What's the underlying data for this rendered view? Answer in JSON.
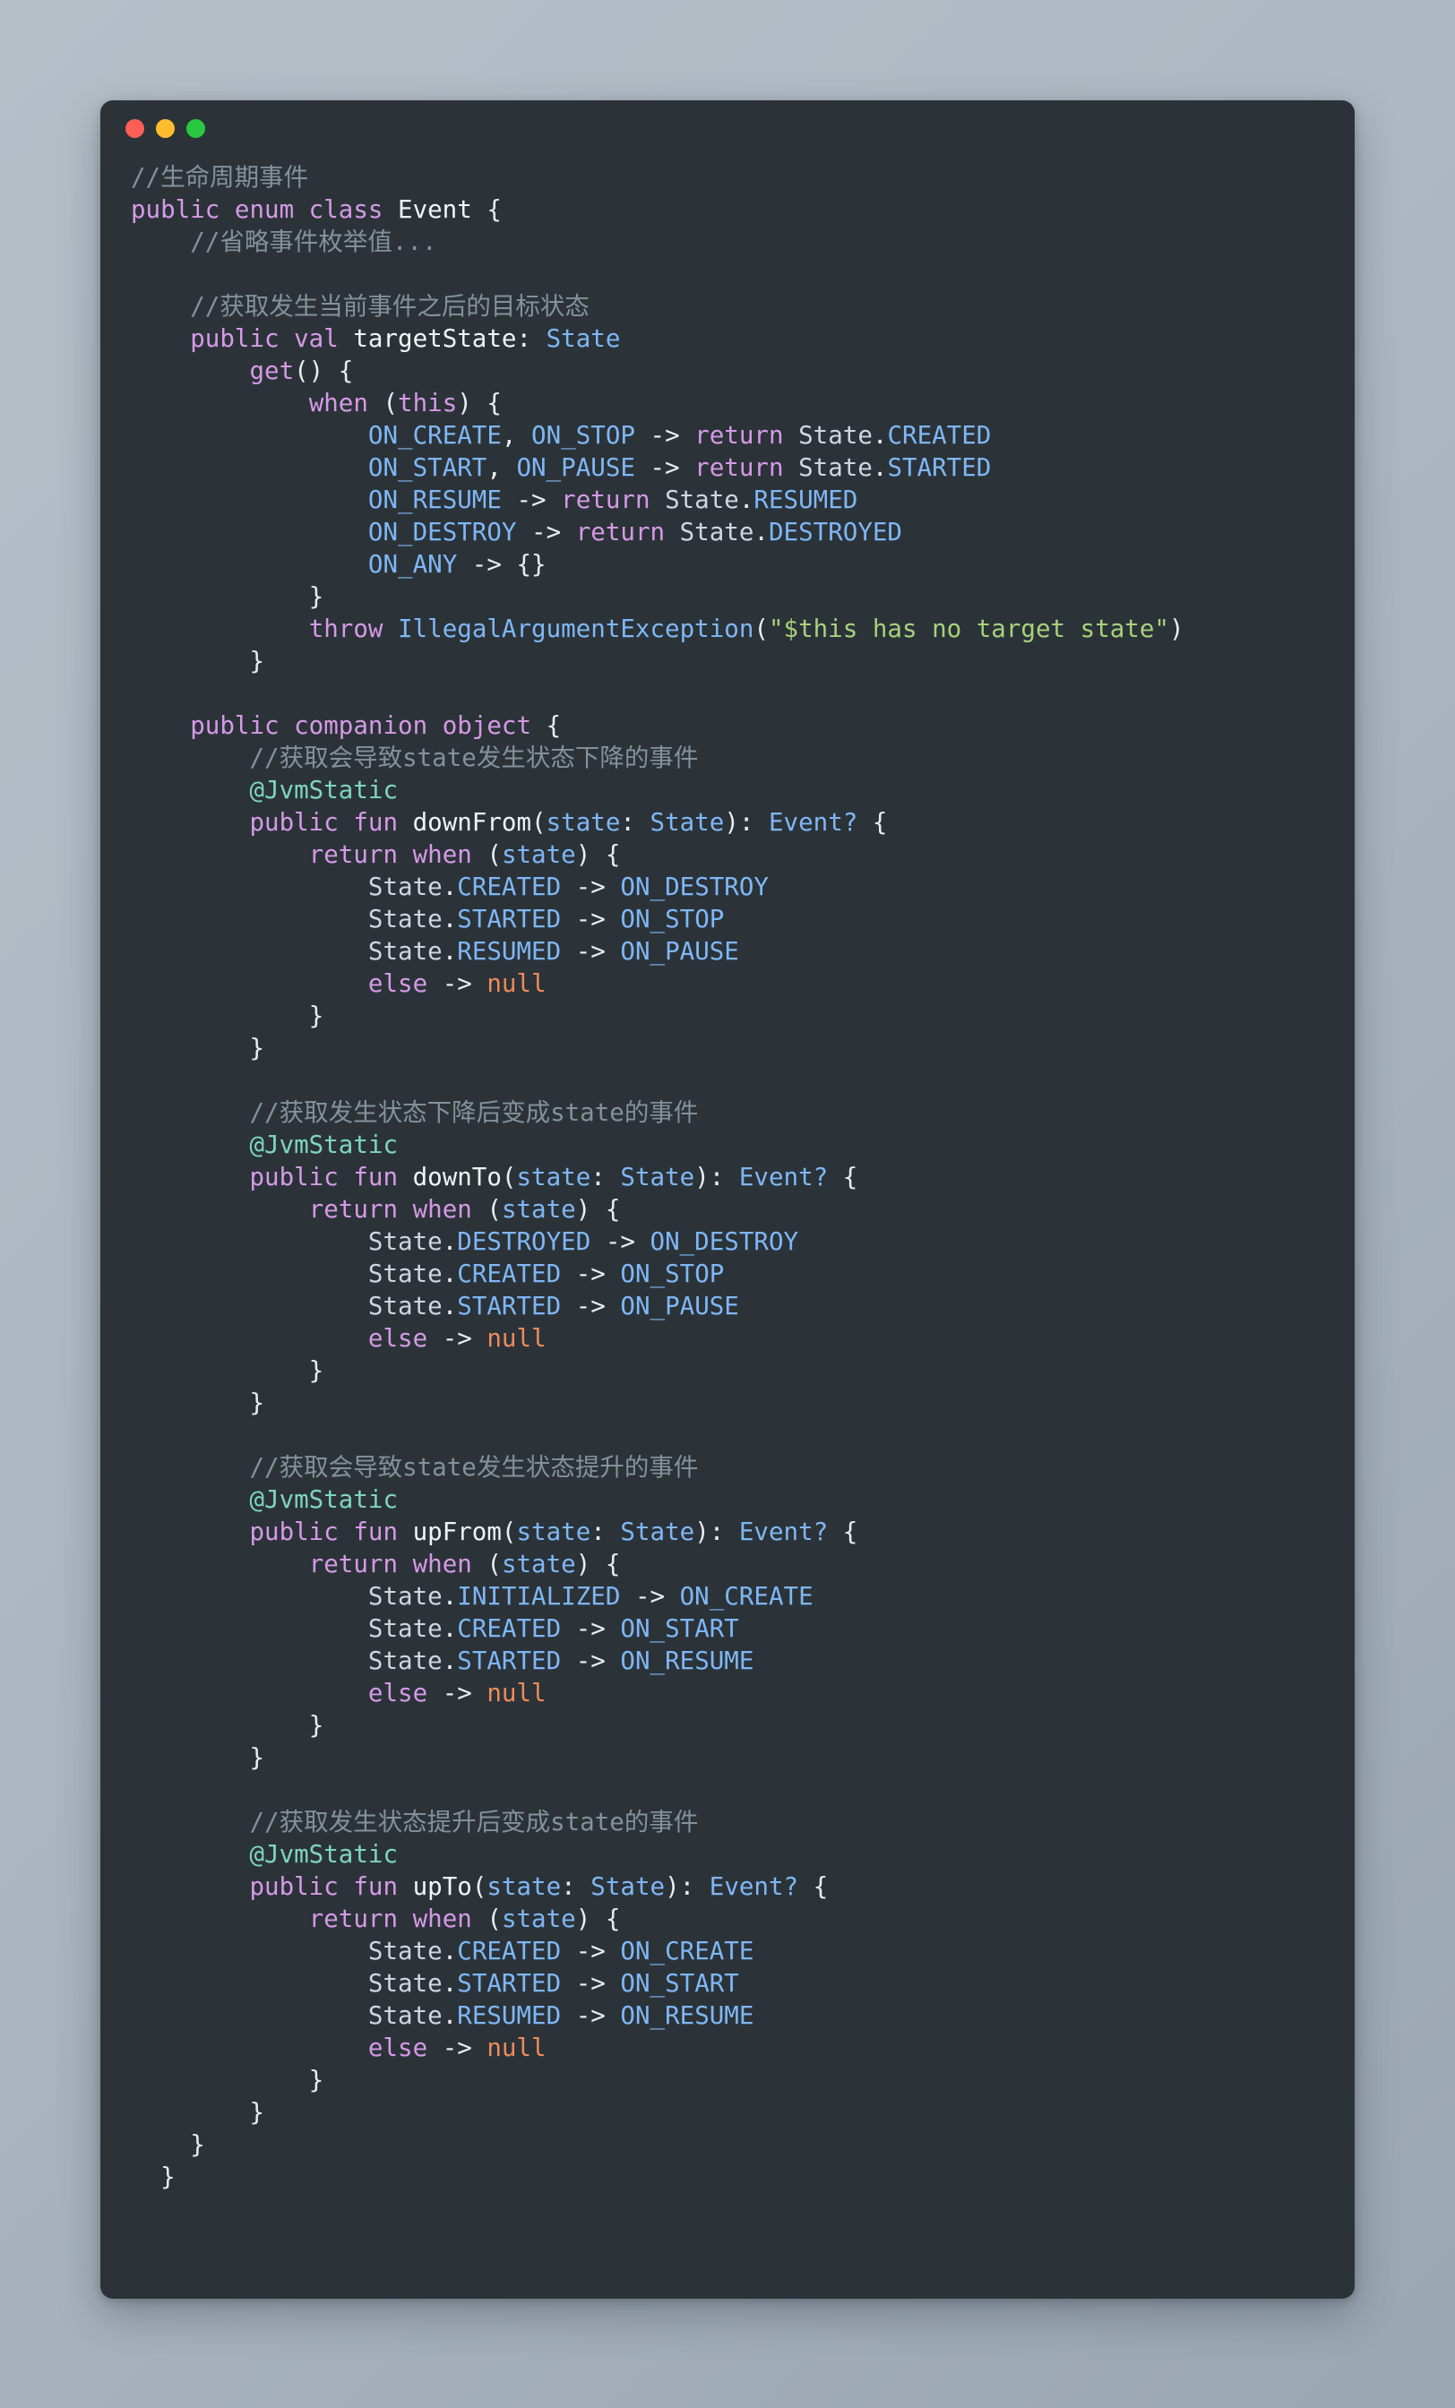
{
  "window": {
    "traffic_lights": [
      {
        "name": "close",
        "color": "#ff5f57"
      },
      {
        "name": "minimize",
        "color": "#ffbd2e"
      },
      {
        "name": "maximize",
        "color": "#28c840"
      }
    ],
    "background_color": "#2b3339",
    "page_background": "#aeb8c2"
  },
  "theme": {
    "comment": "#859199",
    "keyword": "#d699e6",
    "type": "#7fb7f5",
    "function": "#f2f5f7",
    "punctuation": "#e8edf1",
    "string": "#a7d17a",
    "annotation": "#7fd6bb",
    "null": "#ef8a5a",
    "foreground": "#d3dae3"
  },
  "code": {
    "language": "Kotlin",
    "lines": [
      {
        "indent": 0,
        "tokens": [
          {
            "t": "//生命周期事件",
            "c": "cmt"
          }
        ]
      },
      {
        "indent": 0,
        "tokens": [
          {
            "t": "public enum class ",
            "c": "kw"
          },
          {
            "t": "Event",
            "c": "fn"
          },
          {
            "t": " {",
            "c": "pun"
          }
        ]
      },
      {
        "indent": 4,
        "tokens": [
          {
            "t": "//省略事件枚举值...",
            "c": "cmt"
          }
        ]
      },
      {
        "indent": 0,
        "tokens": []
      },
      {
        "indent": 4,
        "tokens": [
          {
            "t": "//获取发生当前事件之后的目标状态",
            "c": "cmt"
          }
        ]
      },
      {
        "indent": 4,
        "tokens": [
          {
            "t": "public val ",
            "c": "kw"
          },
          {
            "t": "targetState",
            "c": "fn"
          },
          {
            "t": ": ",
            "c": "pun"
          },
          {
            "t": "State",
            "c": "typ"
          }
        ]
      },
      {
        "indent": 8,
        "tokens": [
          {
            "t": "get",
            "c": "kw"
          },
          {
            "t": "() {",
            "c": "pun"
          }
        ]
      },
      {
        "indent": 12,
        "tokens": [
          {
            "t": "when ",
            "c": "kw"
          },
          {
            "t": "(",
            "c": "pun"
          },
          {
            "t": "this",
            "c": "kw"
          },
          {
            "t": ") {",
            "c": "pun"
          }
        ]
      },
      {
        "indent": 16,
        "tokens": [
          {
            "t": "ON_CREATE",
            "c": "typ"
          },
          {
            "t": ", ",
            "c": "pun"
          },
          {
            "t": "ON_STOP",
            "c": "typ"
          },
          {
            "t": " -> ",
            "c": "pun"
          },
          {
            "t": "return ",
            "c": "kw"
          },
          {
            "t": "State",
            "c": "ident"
          },
          {
            "t": ".",
            "c": "pun"
          },
          {
            "t": "CREATED",
            "c": "typ"
          }
        ]
      },
      {
        "indent": 16,
        "tokens": [
          {
            "t": "ON_START",
            "c": "typ"
          },
          {
            "t": ", ",
            "c": "pun"
          },
          {
            "t": "ON_PAUSE",
            "c": "typ"
          },
          {
            "t": " -> ",
            "c": "pun"
          },
          {
            "t": "return ",
            "c": "kw"
          },
          {
            "t": "State",
            "c": "ident"
          },
          {
            "t": ".",
            "c": "pun"
          },
          {
            "t": "STARTED",
            "c": "typ"
          }
        ]
      },
      {
        "indent": 16,
        "tokens": [
          {
            "t": "ON_RESUME",
            "c": "typ"
          },
          {
            "t": " -> ",
            "c": "pun"
          },
          {
            "t": "return ",
            "c": "kw"
          },
          {
            "t": "State",
            "c": "ident"
          },
          {
            "t": ".",
            "c": "pun"
          },
          {
            "t": "RESUMED",
            "c": "typ"
          }
        ]
      },
      {
        "indent": 16,
        "tokens": [
          {
            "t": "ON_DESTROY",
            "c": "typ"
          },
          {
            "t": " -> ",
            "c": "pun"
          },
          {
            "t": "return ",
            "c": "kw"
          },
          {
            "t": "State",
            "c": "ident"
          },
          {
            "t": ".",
            "c": "pun"
          },
          {
            "t": "DESTROYED",
            "c": "typ"
          }
        ]
      },
      {
        "indent": 16,
        "tokens": [
          {
            "t": "ON_ANY",
            "c": "typ"
          },
          {
            "t": " -> {}",
            "c": "pun"
          }
        ]
      },
      {
        "indent": 12,
        "tokens": [
          {
            "t": "}",
            "c": "pun"
          }
        ]
      },
      {
        "indent": 12,
        "tokens": [
          {
            "t": "throw ",
            "c": "kw"
          },
          {
            "t": "IllegalArgumentException",
            "c": "typ"
          },
          {
            "t": "(",
            "c": "pun"
          },
          {
            "t": "\"$this has no target state\"",
            "c": "str"
          },
          {
            "t": ")",
            "c": "pun"
          }
        ]
      },
      {
        "indent": 8,
        "tokens": [
          {
            "t": "}",
            "c": "pun"
          }
        ]
      },
      {
        "indent": 0,
        "tokens": []
      },
      {
        "indent": 4,
        "tokens": [
          {
            "t": "public companion object ",
            "c": "kw"
          },
          {
            "t": "{",
            "c": "pun"
          }
        ]
      },
      {
        "indent": 8,
        "tokens": [
          {
            "t": "//获取会导致state发生状态下降的事件",
            "c": "cmt"
          }
        ]
      },
      {
        "indent": 8,
        "tokens": [
          {
            "t": "@JvmStatic",
            "c": "ann"
          }
        ]
      },
      {
        "indent": 8,
        "tokens": [
          {
            "t": "public fun ",
            "c": "kw"
          },
          {
            "t": "downFrom",
            "c": "fn"
          },
          {
            "t": "(",
            "c": "pun"
          },
          {
            "t": "state",
            "c": "typ"
          },
          {
            "t": ": ",
            "c": "pun"
          },
          {
            "t": "State",
            "c": "typ"
          },
          {
            "t": "): ",
            "c": "pun"
          },
          {
            "t": "Event?",
            "c": "typ"
          },
          {
            "t": " {",
            "c": "pun"
          }
        ]
      },
      {
        "indent": 12,
        "tokens": [
          {
            "t": "return when ",
            "c": "kw"
          },
          {
            "t": "(",
            "c": "pun"
          },
          {
            "t": "state",
            "c": "typ"
          },
          {
            "t": ") {",
            "c": "pun"
          }
        ]
      },
      {
        "indent": 16,
        "tokens": [
          {
            "t": "State",
            "c": "ident"
          },
          {
            "t": ".",
            "c": "pun"
          },
          {
            "t": "CREATED",
            "c": "typ"
          },
          {
            "t": " -> ",
            "c": "pun"
          },
          {
            "t": "ON_DESTROY",
            "c": "typ"
          }
        ]
      },
      {
        "indent": 16,
        "tokens": [
          {
            "t": "State",
            "c": "ident"
          },
          {
            "t": ".",
            "c": "pun"
          },
          {
            "t": "STARTED",
            "c": "typ"
          },
          {
            "t": " -> ",
            "c": "pun"
          },
          {
            "t": "ON_STOP",
            "c": "typ"
          }
        ]
      },
      {
        "indent": 16,
        "tokens": [
          {
            "t": "State",
            "c": "ident"
          },
          {
            "t": ".",
            "c": "pun"
          },
          {
            "t": "RESUMED",
            "c": "typ"
          },
          {
            "t": " -> ",
            "c": "pun"
          },
          {
            "t": "ON_PAUSE",
            "c": "typ"
          }
        ]
      },
      {
        "indent": 16,
        "tokens": [
          {
            "t": "else",
            "c": "kw"
          },
          {
            "t": " -> ",
            "c": "pun"
          },
          {
            "t": "null",
            "c": "nul"
          }
        ]
      },
      {
        "indent": 12,
        "tokens": [
          {
            "t": "}",
            "c": "pun"
          }
        ]
      },
      {
        "indent": 8,
        "tokens": [
          {
            "t": "}",
            "c": "pun"
          }
        ]
      },
      {
        "indent": 0,
        "tokens": []
      },
      {
        "indent": 8,
        "tokens": [
          {
            "t": "//获取发生状态下降后变成state的事件",
            "c": "cmt"
          }
        ]
      },
      {
        "indent": 8,
        "tokens": [
          {
            "t": "@JvmStatic",
            "c": "ann"
          }
        ]
      },
      {
        "indent": 8,
        "tokens": [
          {
            "t": "public fun ",
            "c": "kw"
          },
          {
            "t": "downTo",
            "c": "fn"
          },
          {
            "t": "(",
            "c": "pun"
          },
          {
            "t": "state",
            "c": "typ"
          },
          {
            "t": ": ",
            "c": "pun"
          },
          {
            "t": "State",
            "c": "typ"
          },
          {
            "t": "): ",
            "c": "pun"
          },
          {
            "t": "Event?",
            "c": "typ"
          },
          {
            "t": " {",
            "c": "pun"
          }
        ]
      },
      {
        "indent": 12,
        "tokens": [
          {
            "t": "return when ",
            "c": "kw"
          },
          {
            "t": "(",
            "c": "pun"
          },
          {
            "t": "state",
            "c": "typ"
          },
          {
            "t": ") {",
            "c": "pun"
          }
        ]
      },
      {
        "indent": 16,
        "tokens": [
          {
            "t": "State",
            "c": "ident"
          },
          {
            "t": ".",
            "c": "pun"
          },
          {
            "t": "DESTROYED",
            "c": "typ"
          },
          {
            "t": " -> ",
            "c": "pun"
          },
          {
            "t": "ON_DESTROY",
            "c": "typ"
          }
        ]
      },
      {
        "indent": 16,
        "tokens": [
          {
            "t": "State",
            "c": "ident"
          },
          {
            "t": ".",
            "c": "pun"
          },
          {
            "t": "CREATED",
            "c": "typ"
          },
          {
            "t": " -> ",
            "c": "pun"
          },
          {
            "t": "ON_STOP",
            "c": "typ"
          }
        ]
      },
      {
        "indent": 16,
        "tokens": [
          {
            "t": "State",
            "c": "ident"
          },
          {
            "t": ".",
            "c": "pun"
          },
          {
            "t": "STARTED",
            "c": "typ"
          },
          {
            "t": " -> ",
            "c": "pun"
          },
          {
            "t": "ON_PAUSE",
            "c": "typ"
          }
        ]
      },
      {
        "indent": 16,
        "tokens": [
          {
            "t": "else",
            "c": "kw"
          },
          {
            "t": " -> ",
            "c": "pun"
          },
          {
            "t": "null",
            "c": "nul"
          }
        ]
      },
      {
        "indent": 12,
        "tokens": [
          {
            "t": "}",
            "c": "pun"
          }
        ]
      },
      {
        "indent": 8,
        "tokens": [
          {
            "t": "}",
            "c": "pun"
          }
        ]
      },
      {
        "indent": 0,
        "tokens": []
      },
      {
        "indent": 8,
        "tokens": [
          {
            "t": "//获取会导致state发生状态提升的事件",
            "c": "cmt"
          }
        ]
      },
      {
        "indent": 8,
        "tokens": [
          {
            "t": "@JvmStatic",
            "c": "ann"
          }
        ]
      },
      {
        "indent": 8,
        "tokens": [
          {
            "t": "public fun ",
            "c": "kw"
          },
          {
            "t": "upFrom",
            "c": "fn"
          },
          {
            "t": "(",
            "c": "pun"
          },
          {
            "t": "state",
            "c": "typ"
          },
          {
            "t": ": ",
            "c": "pun"
          },
          {
            "t": "State",
            "c": "typ"
          },
          {
            "t": "): ",
            "c": "pun"
          },
          {
            "t": "Event?",
            "c": "typ"
          },
          {
            "t": " {",
            "c": "pun"
          }
        ]
      },
      {
        "indent": 12,
        "tokens": [
          {
            "t": "return when ",
            "c": "kw"
          },
          {
            "t": "(",
            "c": "pun"
          },
          {
            "t": "state",
            "c": "typ"
          },
          {
            "t": ") {",
            "c": "pun"
          }
        ]
      },
      {
        "indent": 16,
        "tokens": [
          {
            "t": "State",
            "c": "ident"
          },
          {
            "t": ".",
            "c": "pun"
          },
          {
            "t": "INITIALIZED",
            "c": "typ"
          },
          {
            "t": " -> ",
            "c": "pun"
          },
          {
            "t": "ON_CREATE",
            "c": "typ"
          }
        ]
      },
      {
        "indent": 16,
        "tokens": [
          {
            "t": "State",
            "c": "ident"
          },
          {
            "t": ".",
            "c": "pun"
          },
          {
            "t": "CREATED",
            "c": "typ"
          },
          {
            "t": " -> ",
            "c": "pun"
          },
          {
            "t": "ON_START",
            "c": "typ"
          }
        ]
      },
      {
        "indent": 16,
        "tokens": [
          {
            "t": "State",
            "c": "ident"
          },
          {
            "t": ".",
            "c": "pun"
          },
          {
            "t": "STARTED",
            "c": "typ"
          },
          {
            "t": " -> ",
            "c": "pun"
          },
          {
            "t": "ON_RESUME",
            "c": "typ"
          }
        ]
      },
      {
        "indent": 16,
        "tokens": [
          {
            "t": "else",
            "c": "kw"
          },
          {
            "t": " -> ",
            "c": "pun"
          },
          {
            "t": "null",
            "c": "nul"
          }
        ]
      },
      {
        "indent": 12,
        "tokens": [
          {
            "t": "}",
            "c": "pun"
          }
        ]
      },
      {
        "indent": 8,
        "tokens": [
          {
            "t": "}",
            "c": "pun"
          }
        ]
      },
      {
        "indent": 0,
        "tokens": []
      },
      {
        "indent": 8,
        "tokens": [
          {
            "t": "//获取发生状态提升后变成state的事件",
            "c": "cmt"
          }
        ]
      },
      {
        "indent": 8,
        "tokens": [
          {
            "t": "@JvmStatic",
            "c": "ann"
          }
        ]
      },
      {
        "indent": 8,
        "tokens": [
          {
            "t": "public fun ",
            "c": "kw"
          },
          {
            "t": "upTo",
            "c": "fn"
          },
          {
            "t": "(",
            "c": "pun"
          },
          {
            "t": "state",
            "c": "typ"
          },
          {
            "t": ": ",
            "c": "pun"
          },
          {
            "t": "State",
            "c": "typ"
          },
          {
            "t": "): ",
            "c": "pun"
          },
          {
            "t": "Event?",
            "c": "typ"
          },
          {
            "t": " {",
            "c": "pun"
          }
        ]
      },
      {
        "indent": 12,
        "tokens": [
          {
            "t": "return when ",
            "c": "kw"
          },
          {
            "t": "(",
            "c": "pun"
          },
          {
            "t": "state",
            "c": "typ"
          },
          {
            "t": ") {",
            "c": "pun"
          }
        ]
      },
      {
        "indent": 16,
        "tokens": [
          {
            "t": "State",
            "c": "ident"
          },
          {
            "t": ".",
            "c": "pun"
          },
          {
            "t": "CREATED",
            "c": "typ"
          },
          {
            "t": " -> ",
            "c": "pun"
          },
          {
            "t": "ON_CREATE",
            "c": "typ"
          }
        ]
      },
      {
        "indent": 16,
        "tokens": [
          {
            "t": "State",
            "c": "ident"
          },
          {
            "t": ".",
            "c": "pun"
          },
          {
            "t": "STARTED",
            "c": "typ"
          },
          {
            "t": " -> ",
            "c": "pun"
          },
          {
            "t": "ON_START",
            "c": "typ"
          }
        ]
      },
      {
        "indent": 16,
        "tokens": [
          {
            "t": "State",
            "c": "ident"
          },
          {
            "t": ".",
            "c": "pun"
          },
          {
            "t": "RESUMED",
            "c": "typ"
          },
          {
            "t": " -> ",
            "c": "pun"
          },
          {
            "t": "ON_RESUME",
            "c": "typ"
          }
        ]
      },
      {
        "indent": 16,
        "tokens": [
          {
            "t": "else",
            "c": "kw"
          },
          {
            "t": " -> ",
            "c": "pun"
          },
          {
            "t": "null",
            "c": "nul"
          }
        ]
      },
      {
        "indent": 12,
        "tokens": [
          {
            "t": "}",
            "c": "pun"
          }
        ]
      },
      {
        "indent": 8,
        "tokens": [
          {
            "t": "}",
            "c": "pun"
          }
        ]
      },
      {
        "indent": 4,
        "tokens": [
          {
            "t": "}",
            "c": "pun"
          }
        ]
      },
      {
        "indent": 2,
        "tokens": [
          {
            "t": "}",
            "c": "pun"
          }
        ]
      }
    ]
  }
}
